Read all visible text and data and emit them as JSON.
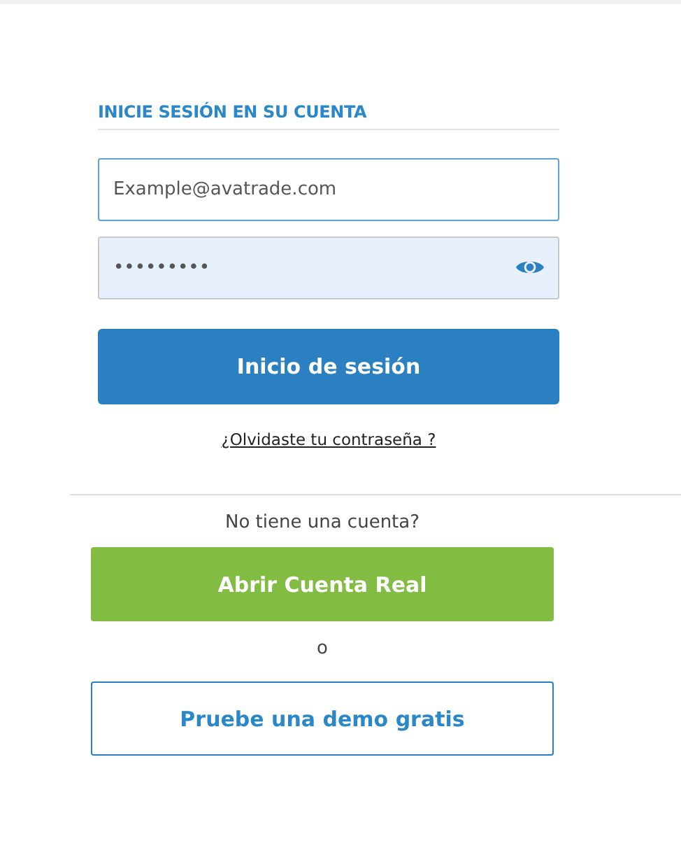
{
  "login": {
    "heading": "INICIE SESIÓN EN SU CUENTA",
    "email": {
      "value": "Example@avatrade.com",
      "focused": true
    },
    "password": {
      "value": "•••••••••",
      "autofilled": true
    },
    "submit": "Inicio de sesión",
    "forgot_link": "¿Olvidaste tu contraseña ?"
  },
  "signup": {
    "prompt": "No tiene una cuenta?",
    "open_account": "Abrir Cuenta Real",
    "separator": "o",
    "demo": "Pruebe una demo gratis"
  }
}
